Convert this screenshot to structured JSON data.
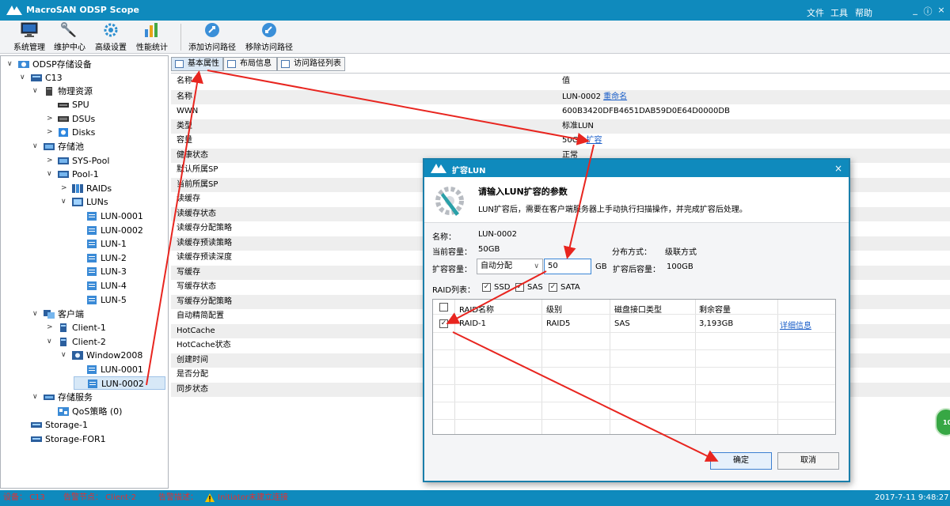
{
  "app": {
    "title": "MacroSAN ODSP Scope",
    "menu": [
      "文件",
      "工具",
      "帮助"
    ],
    "window_controls": [
      "_",
      "ⓘ",
      "×"
    ]
  },
  "toolbar": {
    "items": [
      {
        "label": "系统管理",
        "icon": "monitor-icon"
      },
      {
        "label": "维护中心",
        "icon": "wrench-icon"
      },
      {
        "label": "高级设置",
        "icon": "gear-icon"
      },
      {
        "label": "性能统计",
        "icon": "bar-chart-icon"
      },
      {
        "label": "添加访问路径",
        "icon": "path-add-icon"
      },
      {
        "label": "移除访问路径",
        "icon": "path-remove-icon"
      }
    ]
  },
  "tree": {
    "items": [
      {
        "label": "ODSP存储设备",
        "twisty": "∨"
      },
      {
        "label": "C13",
        "twisty": "∨"
      },
      {
        "label": "物理资源",
        "twisty": "∨"
      },
      {
        "label": "SPU",
        "twisty": ""
      },
      {
        "label": "DSUs",
        "twisty": ">"
      },
      {
        "label": "Disks",
        "twisty": ">"
      },
      {
        "label": "存储池",
        "twisty": "∨"
      },
      {
        "label": "SYS-Pool",
        "twisty": ">"
      },
      {
        "label": "Pool-1",
        "twisty": "∨"
      },
      {
        "label": "RAIDs",
        "twisty": ">"
      },
      {
        "label": "LUNs",
        "twisty": "∨"
      },
      {
        "label": "LUN-0001",
        "twisty": ""
      },
      {
        "label": "LUN-0002",
        "twisty": ""
      },
      {
        "label": "LUN-1",
        "twisty": ""
      },
      {
        "label": "LUN-2",
        "twisty": ""
      },
      {
        "label": "LUN-3",
        "twisty": ""
      },
      {
        "label": "LUN-4",
        "twisty": ""
      },
      {
        "label": "LUN-5",
        "twisty": ""
      },
      {
        "label": "客户端",
        "twisty": "∨"
      },
      {
        "label": "Client-1",
        "twisty": ">"
      },
      {
        "label": "Client-2",
        "twisty": "∨"
      },
      {
        "label": "Window2008",
        "twisty": "∨"
      },
      {
        "label": "LUN-0001",
        "twisty": ""
      },
      {
        "label": "LUN-0002",
        "twisty": ""
      },
      {
        "label": "存储服务",
        "twisty": "∨"
      },
      {
        "label": "QoS策略 (0)",
        "twisty": ""
      },
      {
        "label": "Storage-1",
        "twisty": ""
      },
      {
        "label": "Storage-FOR1",
        "twisty": ""
      }
    ]
  },
  "tabs": [
    {
      "label": "基本属性"
    },
    {
      "label": "布局信息"
    },
    {
      "label": "访问路径列表"
    }
  ],
  "props": {
    "header": {
      "name": "名称",
      "value": "值"
    },
    "rows": [
      {
        "name": "名称",
        "value": "LUN-0002",
        "link": "重命名"
      },
      {
        "name": "WWN",
        "value": "600B3420DFB4651DAB59D0E64D0000DB",
        "link": ""
      },
      {
        "name": "类型",
        "value": "标准LUN",
        "link": ""
      },
      {
        "name": "容量",
        "value": "50GB",
        "link": "扩容"
      },
      {
        "name": "健康状态",
        "value": "正常",
        "link": ""
      },
      {
        "name": "默认所属SP",
        "value": "",
        "link": ""
      },
      {
        "name": "当前所属SP",
        "value": "",
        "link": ""
      },
      {
        "name": "读缓存",
        "value": "",
        "link": ""
      },
      {
        "name": "读缓存状态",
        "value": "",
        "link": ""
      },
      {
        "name": "读缓存分配策略",
        "value": "",
        "link": ""
      },
      {
        "name": "读缓存预读策略",
        "value": "",
        "link": ""
      },
      {
        "name": "读缓存预读深度",
        "value": "",
        "link": ""
      },
      {
        "name": "写缓存",
        "value": "",
        "link": ""
      },
      {
        "name": "写缓存状态",
        "value": "",
        "link": ""
      },
      {
        "name": "写缓存分配策略",
        "value": "",
        "link": ""
      },
      {
        "name": "自动精简配置",
        "value": "",
        "link": ""
      },
      {
        "name": "HotCache",
        "value": "",
        "link": ""
      },
      {
        "name": "HotCache状态",
        "value": "",
        "link": ""
      },
      {
        "name": "创建时间",
        "value": "",
        "link": ""
      },
      {
        "name": "是否分配",
        "value": "",
        "link": ""
      },
      {
        "name": "同步状态",
        "value": "",
        "link": ""
      }
    ]
  },
  "dialog": {
    "title": "扩容LUN",
    "heading": "请输入LUN扩容的参数",
    "description": "LUN扩容后，需要在客户端服务器上手动执行扫描操作，并完成扩容后处理。",
    "name_label": "名称：",
    "name_value": "LUN-0002",
    "current_capacity_label": "当前容量：",
    "current_capacity_value": "50GB",
    "distribution_label": "分布方式：",
    "distribution_value": "级联方式",
    "expand_capacity_label": "扩容容量：",
    "expand_mode": "自动分配",
    "expand_value": "50",
    "unit": "GB",
    "after_label": "扩容后容量：",
    "after_value": "100GB",
    "raid_list_label": "RAID列表：",
    "raid_filters": [
      {
        "label": "SSD",
        "checked": true
      },
      {
        "label": "SAS",
        "checked": true
      },
      {
        "label": "SATA",
        "checked": true
      }
    ],
    "grid": {
      "columns": [
        "RAID名称",
        "级别",
        "磁盘接口类型",
        "剩余容量"
      ],
      "rows": [
        {
          "checked": true,
          "name": "RAID-1",
          "level": "RAID5",
          "interface": "SAS",
          "free": "3,193GB",
          "detail": "详细信息"
        }
      ]
    },
    "ok_label": "确定",
    "cancel_label": "取消"
  },
  "statusbar": {
    "device": "设备：  C13",
    "alarm_node": "告警节点：  Client-2",
    "alarm_desc_label": "告警描述：",
    "alarm_desc": "Initiator未建立连接",
    "datetime": "2017-7-11 9:48:27"
  },
  "badge": {
    "text": "10"
  },
  "colors": {
    "titlebar": "#0f8abd",
    "annotation_arrow": "#e8251f",
    "status_text": "#e53030",
    "link": "#1a5ec8"
  }
}
